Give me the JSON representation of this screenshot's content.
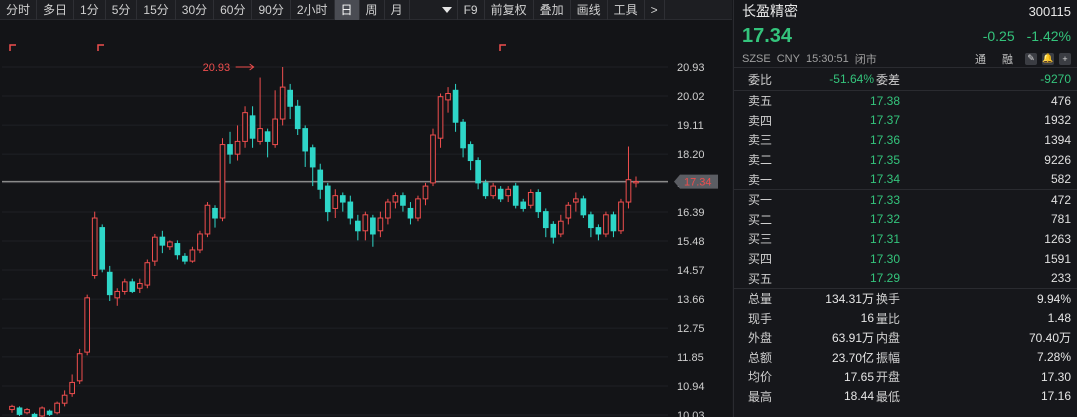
{
  "toolbar": {
    "periods": [
      "分时",
      "多日",
      "1分",
      "5分",
      "15分",
      "30分",
      "60分",
      "90分",
      "2小时",
      "日",
      "周",
      "月"
    ],
    "active_index": 9,
    "tools": [
      "F9",
      "前复权",
      "叠加",
      "画线",
      "工具",
      ">"
    ]
  },
  "chart_data": {
    "type": "candlestick",
    "y_ticks": [
      "20.93",
      "20.02",
      "19.11",
      "18.20",
      "17.30",
      "16.39",
      "15.48",
      "14.57",
      "13.66",
      "12.75",
      "11.85",
      "10.94",
      "10.03"
    ],
    "ylim": [
      10.03,
      20.93
    ],
    "max_marker": "20.93",
    "current_price_label": "17.34",
    "current_price": 17.34,
    "colors": {
      "up": "#ef4e4e",
      "down": "#2ed6c8",
      "price_line": "#8a8a8a",
      "price_tag": "#5b5d63"
    },
    "candles": [
      [
        10.2,
        10.3,
        10.1,
        10.35
      ],
      [
        10.25,
        10.05,
        10.0,
        10.3
      ],
      [
        10.1,
        10.2,
        10.05,
        10.25
      ],
      [
        10.05,
        9.95,
        9.9,
        10.1
      ],
      [
        10.0,
        10.25,
        9.95,
        10.3
      ],
      [
        10.15,
        10.05,
        10.0,
        10.2
      ],
      [
        10.1,
        10.4,
        10.05,
        10.45
      ],
      [
        10.4,
        10.65,
        10.3,
        10.8
      ],
      [
        10.7,
        11.05,
        10.6,
        11.3
      ],
      [
        11.1,
        11.95,
        11.0,
        12.1
      ],
      [
        12.0,
        13.7,
        11.9,
        13.8
      ],
      [
        14.4,
        16.2,
        14.3,
        16.4
      ],
      [
        15.9,
        14.6,
        14.5,
        16.0
      ],
      [
        14.5,
        13.8,
        13.6,
        14.7
      ],
      [
        13.7,
        13.9,
        13.45,
        14.0
      ],
      [
        13.9,
        14.2,
        13.8,
        14.3
      ],
      [
        14.2,
        13.9,
        13.85,
        14.3
      ],
      [
        14.0,
        14.15,
        13.85,
        14.3
      ],
      [
        14.1,
        14.8,
        14.0,
        14.9
      ],
      [
        14.85,
        15.6,
        14.7,
        15.7
      ],
      [
        15.6,
        15.35,
        15.1,
        15.8
      ],
      [
        15.3,
        15.45,
        15.2,
        15.5
      ],
      [
        15.4,
        15.05,
        14.9,
        15.5
      ],
      [
        15.0,
        14.85,
        14.75,
        15.1
      ],
      [
        14.85,
        15.2,
        14.8,
        15.3
      ],
      [
        15.2,
        15.7,
        15.1,
        15.8
      ],
      [
        15.7,
        16.6,
        15.6,
        16.7
      ],
      [
        16.5,
        16.2,
        15.9,
        16.6
      ],
      [
        16.2,
        18.5,
        16.1,
        18.7
      ],
      [
        18.5,
        18.2,
        17.9,
        18.9
      ],
      [
        18.2,
        18.6,
        18.0,
        19.1
      ],
      [
        18.6,
        19.5,
        18.4,
        19.7
      ],
      [
        19.4,
        18.7,
        18.4,
        19.7
      ],
      [
        18.6,
        19.0,
        18.5,
        20.6
      ],
      [
        18.9,
        18.6,
        18.1,
        19.0
      ],
      [
        18.5,
        19.3,
        18.4,
        20.2
      ],
      [
        19.3,
        20.3,
        19.1,
        20.93
      ],
      [
        20.2,
        19.7,
        19.3,
        20.4
      ],
      [
        19.7,
        19.0,
        18.8,
        19.9
      ],
      [
        19.0,
        18.3,
        17.8,
        19.1
      ],
      [
        18.4,
        17.8,
        17.2,
        18.5
      ],
      [
        17.7,
        17.1,
        16.8,
        17.9
      ],
      [
        17.2,
        16.4,
        16.1,
        17.3
      ],
      [
        16.5,
        16.9,
        16.2,
        17.1
      ],
      [
        16.9,
        16.7,
        16.4,
        17.0
      ],
      [
        16.7,
        16.2,
        16.0,
        16.9
      ],
      [
        16.1,
        15.8,
        15.5,
        16.3
      ],
      [
        15.8,
        16.3,
        15.5,
        16.4
      ],
      [
        16.2,
        15.7,
        15.3,
        16.3
      ],
      [
        15.8,
        16.2,
        15.6,
        16.4
      ],
      [
        16.2,
        16.7,
        16.0,
        16.8
      ],
      [
        16.7,
        16.9,
        16.5,
        17.0
      ],
      [
        16.9,
        16.6,
        16.4,
        17.0
      ],
      [
        16.5,
        16.2,
        16.0,
        16.7
      ],
      [
        16.2,
        16.8,
        16.1,
        16.9
      ],
      [
        16.8,
        17.2,
        16.6,
        17.3
      ],
      [
        17.3,
        18.8,
        17.2,
        19.0
      ],
      [
        18.7,
        20.0,
        18.4,
        20.1
      ],
      [
        19.9,
        20.1,
        19.5,
        20.3
      ],
      [
        20.2,
        19.2,
        18.9,
        20.4
      ],
      [
        19.2,
        18.4,
        18.1,
        19.3
      ],
      [
        18.5,
        18.0,
        17.7,
        18.6
      ],
      [
        18.0,
        17.3,
        17.1,
        18.1
      ],
      [
        17.3,
        16.9,
        16.8,
        17.4
      ],
      [
        16.9,
        17.2,
        16.8,
        17.3
      ],
      [
        17.1,
        16.8,
        16.7,
        17.2
      ],
      [
        16.9,
        17.1,
        16.7,
        17.2
      ],
      [
        17.2,
        16.6,
        16.5,
        17.3
      ],
      [
        16.7,
        16.5,
        16.4,
        16.8
      ],
      [
        16.6,
        17.0,
        16.5,
        17.1
      ],
      [
        17.0,
        16.4,
        16.2,
        17.1
      ],
      [
        16.4,
        15.9,
        15.6,
        16.5
      ],
      [
        16.0,
        15.6,
        15.4,
        16.1
      ],
      [
        15.7,
        16.1,
        15.6,
        16.3
      ],
      [
        16.2,
        16.6,
        16.0,
        16.7
      ],
      [
        16.7,
        16.8,
        16.4,
        17.0
      ],
      [
        16.8,
        16.3,
        16.2,
        16.9
      ],
      [
        16.3,
        15.9,
        15.6,
        16.4
      ],
      [
        15.9,
        15.7,
        15.5,
        16.0
      ],
      [
        15.7,
        16.3,
        15.6,
        16.4
      ],
      [
        16.3,
        15.8,
        15.6,
        16.4
      ],
      [
        15.8,
        16.7,
        15.7,
        16.8
      ],
      [
        16.7,
        17.4,
        16.5,
        18.44
      ],
      [
        17.3,
        17.34,
        17.16,
        17.5
      ]
    ]
  },
  "quote": {
    "name": "长盈精密",
    "code": "300115",
    "price": "17.34",
    "change": "-0.25",
    "change_pct": "-1.42%",
    "exchange": "SZSE",
    "currency": "CNY",
    "time": "15:30:51",
    "status": "闭市",
    "tag1": "通",
    "tag2": "融",
    "weibi_label": "委比",
    "weibi": "-51.64%",
    "weicha_label": "委差",
    "weicha": "-9270",
    "asks": [
      {
        "label": "卖五",
        "price": "17.38",
        "vol": "476"
      },
      {
        "label": "卖四",
        "price": "17.37",
        "vol": "1932"
      },
      {
        "label": "卖三",
        "price": "17.36",
        "vol": "1394"
      },
      {
        "label": "卖二",
        "price": "17.35",
        "vol": "9226"
      },
      {
        "label": "卖一",
        "price": "17.34",
        "vol": "582"
      }
    ],
    "bids": [
      {
        "label": "买一",
        "price": "17.33",
        "vol": "472"
      },
      {
        "label": "买二",
        "price": "17.32",
        "vol": "781"
      },
      {
        "label": "买三",
        "price": "17.31",
        "vol": "1263"
      },
      {
        "label": "买四",
        "price": "17.30",
        "vol": "1591"
      },
      {
        "label": "买五",
        "price": "17.29",
        "vol": "233"
      }
    ],
    "stats": [
      {
        "l1": "总量",
        "v1": "134.31万",
        "c1": "white",
        "l2": "换手",
        "v2": "9.94%",
        "c2": "white"
      },
      {
        "l1": "现手",
        "v1": "16",
        "c1": "white",
        "l2": "量比",
        "v2": "1.48",
        "c2": "white"
      },
      {
        "l1": "外盘",
        "v1": "63.91万",
        "c1": "red",
        "l2": "内盘",
        "v2": "70.40万",
        "c2": "green"
      },
      {
        "l1": "总额",
        "v1": "23.70亿",
        "c1": "white",
        "l2": "振幅",
        "v2": "7.28%",
        "c2": "white"
      },
      {
        "l1": "均价",
        "v1": "17.65",
        "c1": "red",
        "l2": "开盘",
        "v2": "17.30",
        "c2": "green"
      },
      {
        "l1": "最高",
        "v1": "18.44",
        "c1": "red",
        "l2": "最低",
        "v2": "17.16",
        "c2": "green"
      }
    ]
  }
}
